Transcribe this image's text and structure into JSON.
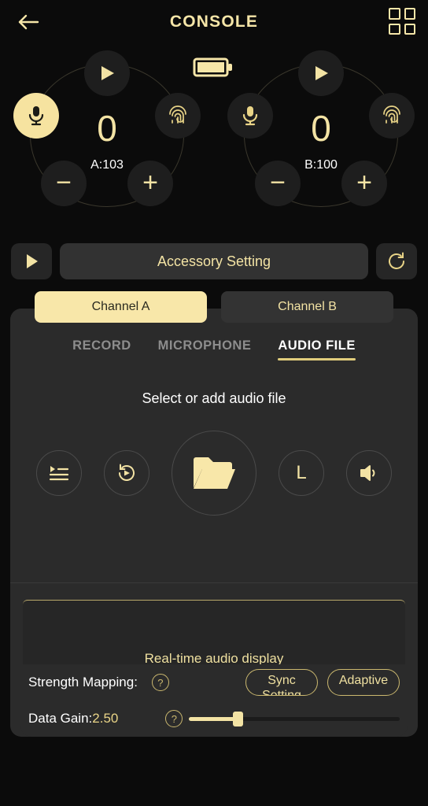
{
  "header": {
    "title": "CONSOLE",
    "back_icon": "back-arrow-icon",
    "grid_icon": "grid-icon"
  },
  "status": {
    "battery_icon": "battery-full-icon"
  },
  "channels": [
    {
      "id": "A",
      "value": "0",
      "label": "A:103",
      "play_icon": "play-icon",
      "mic_icon": "microphone-icon",
      "mic_active": true,
      "fingerprint_icon": "fingerprint-icon",
      "minus_label": "−",
      "plus_label": "+"
    },
    {
      "id": "B",
      "value": "0",
      "label": "B:100",
      "play_icon": "play-icon",
      "mic_icon": "microphone-icon",
      "mic_active": false,
      "fingerprint_icon": "fingerprint-icon",
      "minus_label": "−",
      "plus_label": "+"
    }
  ],
  "accessory": {
    "play_icon": "play-icon",
    "label": "Accessory Setting",
    "refresh_icon": "refresh-icon"
  },
  "channel_tabs": [
    {
      "label": "Channel A",
      "selected": true
    },
    {
      "label": "Channel B",
      "selected": false
    }
  ],
  "source_tabs": [
    {
      "label": "RECORD",
      "selected": false
    },
    {
      "label": "MICROPHONE",
      "selected": false
    },
    {
      "label": "AUDIO FILE",
      "selected": true
    }
  ],
  "audio_file": {
    "hint": "Select or add audio file",
    "actions": [
      {
        "icon": "playlist-icon",
        "label": ""
      },
      {
        "icon": "replay-icon",
        "label": ""
      },
      {
        "icon": "folder-open-icon",
        "label": ""
      },
      {
        "icon": "loop-letter-icon",
        "label": "L"
      },
      {
        "icon": "volume-icon",
        "label": ""
      }
    ]
  },
  "realtime_display": {
    "label": "Real-time audio display"
  },
  "bottom_controls": {
    "strength_mapping": {
      "label": "Strength Mapping:",
      "help_icon": "help-icon",
      "buttons": [
        {
          "line1": "Sync",
          "line2": "Setting"
        },
        {
          "line1": "Adaptive",
          "line2": ""
        }
      ]
    },
    "data_gain": {
      "label": "Data Gain:",
      "value": "2.50",
      "help_icon": "help-icon",
      "slider_percent": 23
    }
  },
  "colors": {
    "accent": "#f3e3a4",
    "accent_solid": "#f8e7a9",
    "bg": "#0b0b0b",
    "card": "#2b2b2b"
  }
}
